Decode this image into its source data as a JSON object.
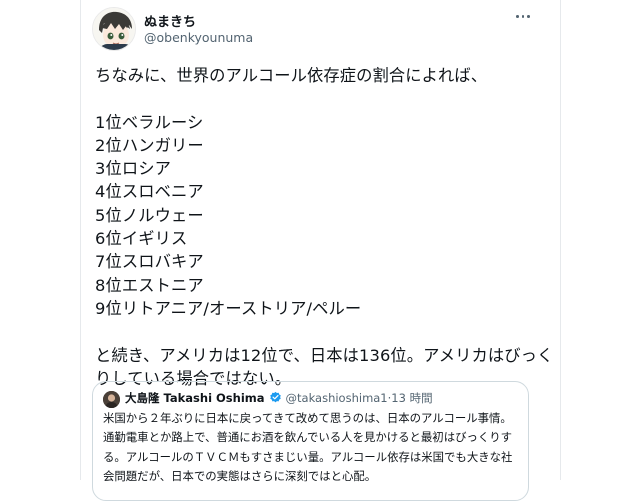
{
  "author": {
    "display_name": "ぬまきち",
    "handle": "@obenkyounuma"
  },
  "tweet": {
    "text": "ちなみに、世界のアルコール依存症の割合によれば、\n\n1位ベラルーシ\n2位ハンガリー\n3位ロシア\n4位スロベニア\n5位ノルウェー\n6位イギリス\n7位スロバキア\n8位エストニア\n9位リトアニア/オーストリア/ペルー\n\nと続き、アメリカは12位で、日本は136位。アメリカはびっくりしている場合ではない。"
  },
  "quote": {
    "name": "大島隆 Takashi Oshima",
    "handle": "@takashioshima1",
    "separator": "·",
    "time": "13 時間",
    "text": "米国から２年ぶりに日本に戻ってきて改めて思うのは、日本のアルコール事情。\n通勤電車とか路上で、普通にお酒を飲んでいる人を見かけると最初はびっくりする。アルコールのＴＶＣＭもすさまじい量。アルコール依存は米国でも大きな社会問題だが、日本での実態はさらに深刻ではと心配。"
  },
  "icons": {
    "more": "more-horizontal-icon",
    "verified": "verified-badge-icon"
  },
  "colors": {
    "text": "#0f1419",
    "secondary": "#536471",
    "verified": "#1d9bf0",
    "border": "#cfd9de"
  }
}
